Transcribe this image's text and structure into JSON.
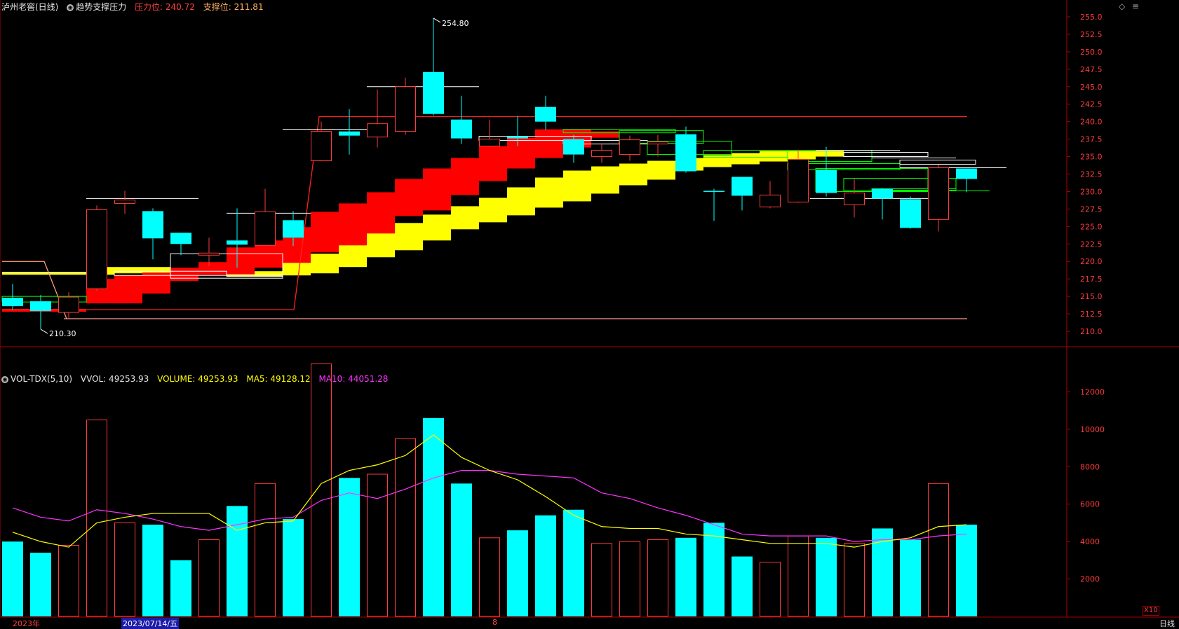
{
  "price_header": {
    "stock_title": "泸州老窖(日线)",
    "indicator_name": "趋势支撑压力",
    "resistance_label": "压力位: 240.72",
    "support_label": "支撑位: 211.81"
  },
  "vol_header": {
    "indicator": "VOL-TDX(5,10)",
    "vvol": "VVOL: 49253.93",
    "volume": "VOLUME: 49253.93",
    "ma5": "MA5: 49128.12",
    "ma10": "MA10: 44051.28"
  },
  "footer": {
    "year_label": "2023年",
    "cursor_date": "2023/07/14/五",
    "month_label": "8",
    "period": "日线",
    "multiplier": "X10"
  },
  "colors": {
    "up": "#ff3c3c",
    "down": "#00ffff",
    "ma5": "#ffff00",
    "ma10": "#ff33ff",
    "resistance": "#ff2020",
    "support": "#ff9a9a",
    "band_red": "#ff0000",
    "band_yellow": "#ffff00",
    "axis": "#aa0000"
  },
  "chart_data": [
    {
      "type": "candlestick",
      "title": "泸州老窖(日线)",
      "ylim": [
        208.5,
        256
      ],
      "y_ticks": [
        "255.0",
        "252.5",
        "250.0",
        "247.5",
        "245.0",
        "242.5",
        "240.0",
        "237.5",
        "235.0",
        "232.5",
        "230.0",
        "227.5",
        "225.0",
        "222.5",
        "220.0",
        "217.5",
        "215.0",
        "212.5",
        "210.0"
      ],
      "candles": [
        {
          "o": 214.8,
          "h": 216.8,
          "l": 213.1,
          "c": 213.6
        },
        {
          "o": 214.3,
          "h": 215.2,
          "l": 210.3,
          "c": 212.9
        },
        {
          "o": 212.7,
          "h": 215.6,
          "l": 211.9,
          "c": 214.9
        },
        {
          "o": 216.1,
          "h": 228.0,
          "l": 215.8,
          "c": 227.4
        },
        {
          "o": 228.3,
          "h": 230.1,
          "l": 226.8,
          "c": 228.8
        },
        {
          "o": 227.2,
          "h": 227.6,
          "l": 220.3,
          "c": 223.3
        },
        {
          "o": 224.1,
          "h": 224.1,
          "l": 220.9,
          "c": 222.5
        },
        {
          "o": 220.9,
          "h": 223.4,
          "l": 219.3,
          "c": 221.2
        },
        {
          "o": 223.0,
          "h": 227.6,
          "l": 219.1,
          "c": 222.4
        },
        {
          "o": 222.3,
          "h": 230.4,
          "l": 222.3,
          "c": 227.1
        },
        {
          "o": 225.9,
          "h": 227.2,
          "l": 222.2,
          "c": 223.4
        },
        {
          "o": 234.4,
          "h": 240.0,
          "l": 234.3,
          "c": 238.6
        },
        {
          "o": 238.6,
          "h": 241.8,
          "l": 235.3,
          "c": 238.0
        },
        {
          "o": 237.8,
          "h": 244.6,
          "l": 236.3,
          "c": 239.7
        },
        {
          "o": 238.6,
          "h": 246.3,
          "l": 238.1,
          "c": 245.0
        },
        {
          "o": 247.1,
          "h": 254.8,
          "l": 240.9,
          "c": 241.1
        },
        {
          "o": 240.3,
          "h": 243.7,
          "l": 236.8,
          "c": 237.6
        },
        {
          "o": 236.5,
          "h": 240.3,
          "l": 236.4,
          "c": 237.5
        },
        {
          "o": 237.9,
          "h": 240.8,
          "l": 236.5,
          "c": 237.6
        },
        {
          "o": 242.1,
          "h": 243.7,
          "l": 238.8,
          "c": 240.0
        },
        {
          "o": 237.5,
          "h": 238.1,
          "l": 234.1,
          "c": 235.3
        },
        {
          "o": 235.0,
          "h": 236.9,
          "l": 234.1,
          "c": 235.9
        },
        {
          "o": 235.3,
          "h": 238.0,
          "l": 234.4,
          "c": 237.4
        },
        {
          "o": 236.8,
          "h": 238.1,
          "l": 235.0,
          "c": 237.1
        },
        {
          "o": 238.2,
          "h": 239.3,
          "l": 232.7,
          "c": 232.9
        },
        {
          "o": 230.1,
          "h": 230.4,
          "l": 225.8,
          "c": 230.0
        },
        {
          "o": 232.1,
          "h": 232.1,
          "l": 227.3,
          "c": 229.4
        },
        {
          "o": 227.8,
          "h": 231.5,
          "l": 227.6,
          "c": 229.5
        },
        {
          "o": 228.5,
          "h": 236.0,
          "l": 228.4,
          "c": 234.6
        },
        {
          "o": 233.1,
          "h": 236.4,
          "l": 229.3,
          "c": 229.8
        },
        {
          "o": 228.1,
          "h": 231.9,
          "l": 226.3,
          "c": 229.8
        },
        {
          "o": 230.4,
          "h": 230.5,
          "l": 226.0,
          "c": 229.0
        },
        {
          "o": 228.9,
          "h": 229.3,
          "l": 224.7,
          "c": 224.8
        },
        {
          "o": 226.0,
          "h": 233.8,
          "l": 224.3,
          "c": 233.4
        },
        {
          "o": 233.3,
          "h": 233.3,
          "l": 229.9,
          "c": 231.8
        }
      ],
      "resistance": {
        "value": 240.72
      },
      "support": {
        "value": 211.81
      },
      "labels": {
        "high": "254.80",
        "low": "210.30"
      },
      "band_red": [
        {
          "from": 0,
          "to": 3,
          "lo": 213.2,
          "hi": 213.2
        },
        {
          "from": 3,
          "to": 5,
          "lo": 214.0,
          "hi": 217.5
        },
        {
          "from": 4,
          "to": 6,
          "lo": 215.4,
          "hi": 218.0
        },
        {
          "from": 5,
          "to": 7,
          "lo": 217.2,
          "hi": 218.4
        },
        {
          "from": 6,
          "to": 8,
          "lo": 218.1,
          "hi": 219.1
        },
        {
          "from": 7,
          "to": 9,
          "lo": 218.1,
          "hi": 219.9
        },
        {
          "from": 8,
          "to": 10,
          "lo": 219.1,
          "hi": 222.0
        },
        {
          "from": 9,
          "to": 11,
          "lo": 219.8,
          "hi": 223.0
        },
        {
          "from": 10,
          "to": 12,
          "lo": 221.3,
          "hi": 224.9
        },
        {
          "from": 11,
          "to": 13,
          "lo": 222.3,
          "hi": 227.1
        },
        {
          "from": 12,
          "to": 14,
          "lo": 224.0,
          "hi": 228.3
        },
        {
          "from": 13,
          "to": 15,
          "lo": 226.5,
          "hi": 229.9
        },
        {
          "from": 14,
          "to": 16,
          "lo": 227.3,
          "hi": 231.8
        },
        {
          "from": 15,
          "to": 17,
          "lo": 229.5,
          "hi": 233.3
        },
        {
          "from": 16,
          "to": 18,
          "lo": 231.5,
          "hi": 234.8
        },
        {
          "from": 17,
          "to": 19,
          "lo": 233.3,
          "hi": 236.5
        },
        {
          "from": 18,
          "to": 20,
          "lo": 234.8,
          "hi": 237.7
        },
        {
          "from": 19,
          "to": 21,
          "lo": 236.3,
          "hi": 238.9
        },
        {
          "from": 20,
          "to": 22,
          "lo": 237.7,
          "hi": 238.6
        }
      ],
      "band_yellow": [
        {
          "from": 0,
          "to": 4,
          "lo": 218.3,
          "hi": 218.5
        },
        {
          "from": 3,
          "to": 6,
          "lo": 218.3,
          "hi": 219.2
        },
        {
          "from": 8,
          "to": 10,
          "lo": 217.8,
          "hi": 218.3
        },
        {
          "from": 9,
          "to": 11,
          "lo": 218.0,
          "hi": 218.6
        },
        {
          "from": 10,
          "to": 12,
          "lo": 218.3,
          "hi": 220.0
        },
        {
          "from": 11,
          "to": 13,
          "lo": 219.2,
          "hi": 221.1
        },
        {
          "from": 12,
          "to": 14,
          "lo": 220.6,
          "hi": 222.6
        },
        {
          "from": 13,
          "to": 15,
          "lo": 221.6,
          "hi": 224.2
        },
        {
          "from": 14,
          "to": 16,
          "lo": 223.0,
          "hi": 225.5
        },
        {
          "from": 15,
          "to": 17,
          "lo": 224.6,
          "hi": 226.7
        },
        {
          "from": 16,
          "to": 18,
          "lo": 225.6,
          "hi": 227.9
        },
        {
          "from": 17,
          "to": 19,
          "lo": 226.6,
          "hi": 229.1
        },
        {
          "from": 18,
          "to": 20,
          "lo": 227.7,
          "hi": 230.6
        },
        {
          "from": 19,
          "to": 21,
          "lo": 228.6,
          "hi": 232.0
        },
        {
          "from": 20,
          "to": 22,
          "lo": 229.7,
          "hi": 233.0
        },
        {
          "from": 21,
          "to": 23,
          "lo": 230.9,
          "hi": 233.6
        },
        {
          "from": 22,
          "to": 24,
          "lo": 231.7,
          "hi": 234.0
        },
        {
          "from": 23,
          "to": 25,
          "lo": 233.0,
          "hi": 234.4
        },
        {
          "from": 24,
          "to": 26,
          "lo": 233.5,
          "hi": 234.8
        },
        {
          "from": 25,
          "to": 27,
          "lo": 233.9,
          "hi": 235.2
        },
        {
          "from": 26,
          "to": 28,
          "lo": 234.3,
          "hi": 235.5
        },
        {
          "from": 27,
          "to": 29,
          "lo": 234.6,
          "hi": 235.8
        },
        {
          "from": 28,
          "to": 30,
          "lo": 235.0,
          "hi": 235.8
        }
      ],
      "step_lines": [
        {
          "color": "#ffa07a",
          "points": [
            [
              0,
              220.0
            ],
            [
              1.5,
              220.0
            ],
            [
              2.3,
              211.8
            ]
          ]
        },
        {
          "color": "#ff2020",
          "points": [
            [
              0,
              213.1
            ],
            [
              10.4,
              213.1
            ],
            [
              11.3,
              240.72
            ],
            [
              34.4,
              240.72
            ]
          ]
        },
        {
          "color": "#ff9a9a",
          "points": [
            [
              2.2,
              211.81
            ],
            [
              34.4,
              211.81
            ]
          ]
        }
      ],
      "ladder_boxes": [
        {
          "color": "#ffffff",
          "from": 0,
          "to": 3,
          "lo": 218.4,
          "hi": 218.4
        },
        {
          "color": "#ffffff",
          "from": 3,
          "to": 7,
          "lo": 229.0,
          "hi": 229.0
        },
        {
          "color": "#ffffff",
          "from": 4,
          "to": 8,
          "lo": 218.0,
          "hi": 218.6
        },
        {
          "color": "#ffffff",
          "from": 6,
          "to": 10,
          "lo": 217.6,
          "hi": 221.1
        },
        {
          "color": "#ffffff",
          "from": 8,
          "to": 10,
          "lo": 217.9,
          "hi": 218.1
        },
        {
          "color": "#ffffff",
          "from": 8,
          "to": 11,
          "lo": 226.9,
          "hi": 226.9
        },
        {
          "color": "#ffffff",
          "from": 10,
          "to": 13,
          "lo": 238.9,
          "hi": 238.9
        },
        {
          "color": "#ffffff",
          "from": 13,
          "to": 17,
          "lo": 245.0,
          "hi": 245.0
        },
        {
          "color": "#ffffff",
          "from": 17,
          "to": 21,
          "lo": 237.3,
          "hi": 237.9
        },
        {
          "color": "#ffffff",
          "from": 20,
          "to": 23,
          "lo": 236.8,
          "hi": 237.3
        },
        {
          "color": "#00ff00",
          "from": 0,
          "to": 3,
          "lo": 214.2,
          "hi": 215.0
        },
        {
          "color": "#00ff00",
          "from": 20,
          "to": 24,
          "lo": 238.4,
          "hi": 238.9
        },
        {
          "color": "#00ff00",
          "from": 22,
          "to": 25,
          "lo": 236.9,
          "hi": 238.7
        },
        {
          "color": "#00ff00",
          "from": 23,
          "to": 26,
          "lo": 235.3,
          "hi": 237.2
        },
        {
          "color": "#00ff00",
          "from": 25,
          "to": 28,
          "lo": 234.9,
          "hi": 235.9
        },
        {
          "color": "#00ff00",
          "from": 28,
          "to": 31,
          "lo": 234.3,
          "hi": 235.9
        },
        {
          "color": "#00ff00",
          "from": 28,
          "to": 32,
          "lo": 233.1,
          "hi": 234.0
        },
        {
          "color": "#00ff00",
          "from": 29,
          "to": 33,
          "lo": 230.0,
          "hi": 233.3
        },
        {
          "color": "#00ff00",
          "from": 30,
          "to": 34,
          "lo": 230.1,
          "hi": 231.9
        },
        {
          "color": "#00ff00",
          "from": 31,
          "to": 34,
          "lo": 230.2,
          "hi": 230.4
        },
        {
          "color": "#00ff00",
          "from": 33,
          "to": 35.2,
          "lo": 230.1,
          "hi": 230.1
        },
        {
          "color": "#ffffff",
          "from": 29,
          "to": 32,
          "lo": 235.9,
          "hi": 235.9
        },
        {
          "color": "#ffffff",
          "from": 30,
          "to": 33,
          "lo": 235.0,
          "hi": 235.6
        },
        {
          "color": "#ffffff",
          "from": 31,
          "to": 34,
          "lo": 234.8,
          "hi": 234.8
        },
        {
          "color": "#ffffff",
          "from": 32,
          "to": 34.7,
          "lo": 233.9,
          "hi": 234.5
        },
        {
          "color": "#ffffff",
          "from": 32,
          "to": 35.8,
          "lo": 233.4,
          "hi": 233.4
        },
        {
          "color": "#ffffff",
          "from": 28.8,
          "to": 33.5,
          "lo": 229.0,
          "hi": 229.0
        }
      ]
    },
    {
      "type": "bar",
      "title": "VOL-TDX(5,10)",
      "ylim": [
        0,
        14000
      ],
      "y_ticks": [
        "12000",
        "10000",
        "8000",
        "6000",
        "4000",
        "2000"
      ],
      "volume": [
        4000,
        3400,
        3800,
        10500,
        5000,
        4900,
        3000,
        4100,
        5900,
        7100,
        5200,
        13500,
        7400,
        7600,
        9500,
        10600,
        7100,
        4200,
        4600,
        5400,
        5700,
        3900,
        4000,
        4100,
        4200,
        5000,
        3200,
        2900,
        4300,
        4200,
        3900,
        4700,
        4100,
        7100,
        4900
      ],
      "ma5": [
        4500,
        4000,
        3700,
        5000,
        5300,
        5500,
        5500,
        5500,
        4600,
        5000,
        5100,
        7100,
        7800,
        8100,
        8600,
        9700,
        8500,
        7800,
        7300,
        6400,
        5400,
        4800,
        4700,
        4700,
        4400,
        4300,
        4100,
        3900,
        3900,
        3900,
        3700,
        4000,
        4200,
        4800,
        4900
      ],
      "ma10": [
        5800,
        5300,
        5100,
        5700,
        5500,
        5200,
        4800,
        4600,
        4900,
        5200,
        5300,
        6200,
        6600,
        6300,
        6800,
        7400,
        7800,
        7800,
        7600,
        7500,
        7400,
        6600,
        6300,
        5800,
        5400,
        4900,
        4400,
        4300,
        4300,
        4300,
        4000,
        4100,
        4100,
        4300,
        4400
      ]
    }
  ]
}
